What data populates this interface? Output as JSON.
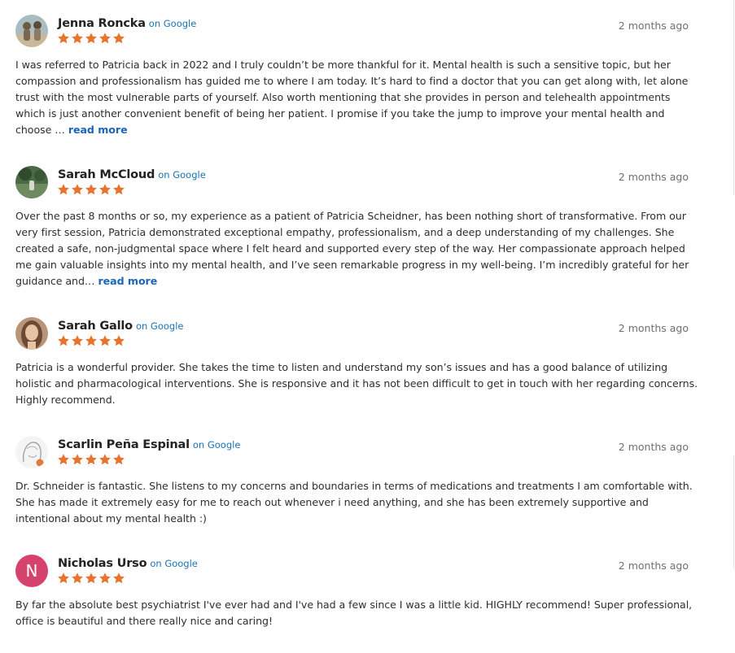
{
  "reviews": [
    {
      "author": "Jenna Roncka",
      "source": "on Google",
      "time": "2 months ago",
      "rating": 5,
      "avatar_type": "photo",
      "avatar_colors": [
        "#9fb3b8",
        "#6b5a45"
      ],
      "text": "I was referred to Patricia back in 2022 and I truly couldn’t be more thankful for it. Mental health is such a sensitive topic, but her compassion and professionalism has guided me to where I am today. It’s hard to find a doctor that you can get along with, let alone trust with the most vulnerable parts of yourself. Also worth mentioning that she provides in person and telehealth appointments which is just another convenient benefit of being her patient. I promise if you take the jump to improve your mental health and choose …",
      "read_more": "read more"
    },
    {
      "author": "Sarah McCloud",
      "source": "on Google",
      "time": "2 months ago",
      "rating": 5,
      "avatar_type": "photo",
      "avatar_colors": [
        "#3c5a3a",
        "#8a9a7a"
      ],
      "text": "Over the past 8 months or so, my experience as a patient of Patricia Scheidner, has been nothing short of transformative. From our very first session, Patricia demonstrated exceptional empathy, professionalism, and a deep understanding of my challenges. She created a safe, non-judgmental space where I felt heard and supported every step of the way. Her compassionate approach helped me gain valuable insights into my mental health, and I’ve seen remarkable progress in my well-being. I’m incredibly grateful for her guidance and…",
      "read_more": "read more"
    },
    {
      "author": "Sarah Gallo",
      "source": "on Google",
      "time": "2 months ago",
      "rating": 5,
      "avatar_type": "photo",
      "avatar_colors": [
        "#c9a184",
        "#6e4a34"
      ],
      "text": "Patricia is a wonderful provider. She takes the time to listen and understand my son’s issues and has a good balance of utilizing holistic and pharmacological interventions. She is responsive and it has not been difficult to get in touch with her regarding concerns. Highly recommend.",
      "read_more": ""
    },
    {
      "author": "Scarlin Peña Espinal",
      "source": "on Google",
      "time": "2 months ago",
      "rating": 5,
      "avatar_type": "sketch",
      "avatar_colors": [
        "#f1f1f1",
        "#e07a3c"
      ],
      "text": "Dr. Schneider is fantastic. She listens to my concerns and boundaries in terms of medications and treatments I am comfortable with. She has made it extremely easy for me to reach out whenever i need anything, and she has been extremely supportive and intentional about my mental health :)",
      "read_more": ""
    },
    {
      "author": "Nicholas Urso",
      "source": "on Google",
      "time": "2 months ago",
      "rating": 5,
      "avatar_type": "letter",
      "avatar_letter": "N",
      "avatar_colors": [
        "#d5436d",
        "#ffffff"
      ],
      "text": "By far the absolute best psychiatrist I've ever had and I've had a few since I was a little kid. HIGHLY recommend! Super professional, office is beautiful and there really nice and caring!",
      "read_more": ""
    }
  ],
  "colors": {
    "star": "#e8732e",
    "link": "#1a66b8",
    "source": "#1a73b8"
  },
  "icons": {
    "star": "star-icon"
  }
}
